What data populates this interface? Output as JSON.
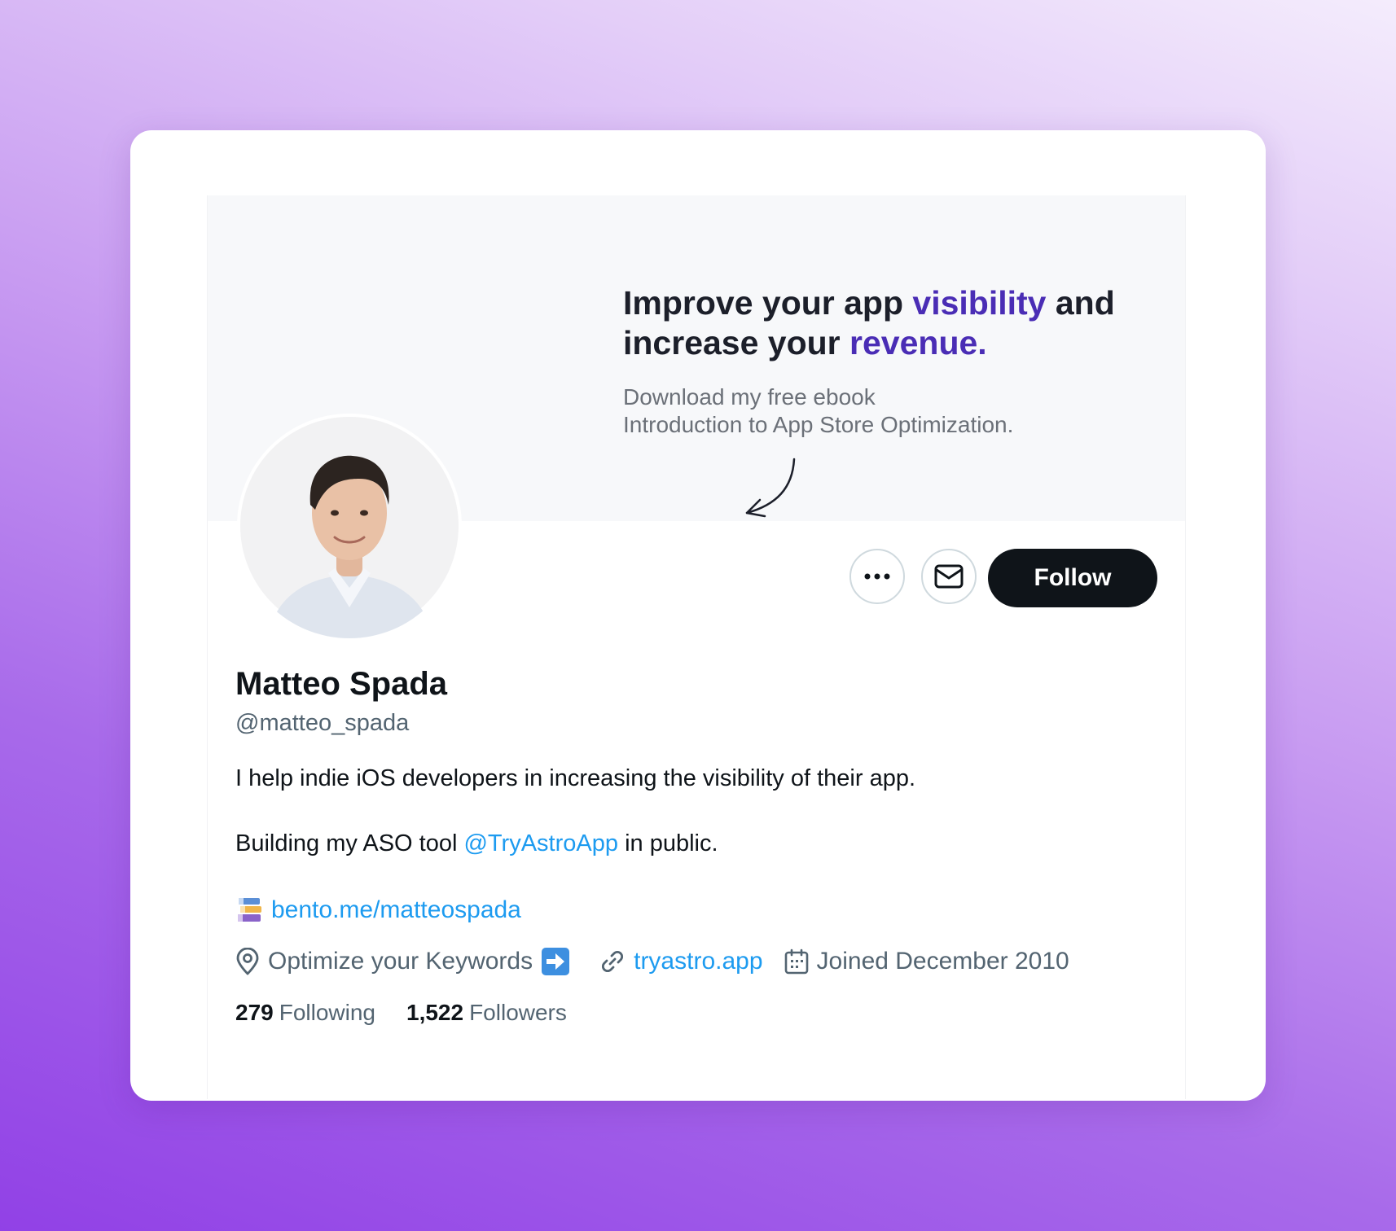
{
  "banner": {
    "headline_part1": "Improve your app ",
    "headline_accent1": "visibility",
    "headline_part2": " and increase your ",
    "headline_accent2": "revenue.",
    "sub_line1": "Download my free ebook",
    "sub_line2": "Introduction to App Store Optimization."
  },
  "actions": {
    "follow_label": "Follow"
  },
  "profile": {
    "name": "Matteo Spada",
    "handle": "@matteo_spada",
    "bio_line1": "I help indie iOS developers in increasing the visibility of their app.",
    "bio_line2_prefix": "Building my ASO tool ",
    "bio_line2_mention": "@TryAstroApp",
    "bio_line2_suffix": " in public.",
    "bento_link": "bento.me/matteospada"
  },
  "meta": {
    "location": "Optimize your Keywords",
    "website": "tryastro.app",
    "joined": "Joined December 2010"
  },
  "stats": {
    "following_count": "279",
    "following_label": "Following",
    "followers_count": "1,522",
    "followers_label": "Followers"
  },
  "icons": [
    "more-icon",
    "mail-icon",
    "books-icon",
    "location-pin-icon",
    "right-arrow-icon",
    "link-icon",
    "calendar-icon"
  ],
  "colors": {
    "accent": "#4a2db5",
    "link": "#1d9bf0",
    "follow_button": "#0f1419",
    "muted_text": "#536471"
  }
}
